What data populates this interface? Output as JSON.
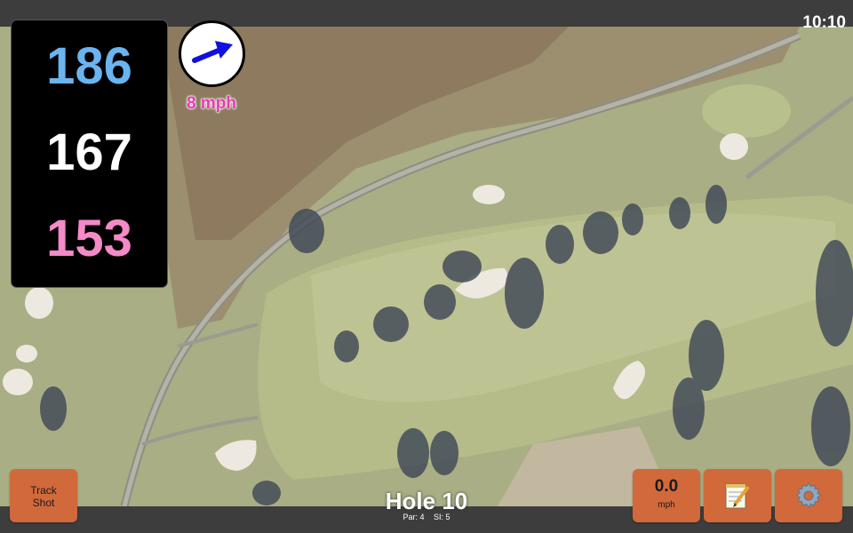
{
  "status": {
    "time": "10:10"
  },
  "distances": {
    "back": "186",
    "middle": "167",
    "front": "153"
  },
  "wind": {
    "speed_label": "8 mph",
    "arrow_icon": "wind-arrow-icon"
  },
  "hole": {
    "title": "Hole 10",
    "par_label": "Par: 4",
    "si_label": "SI: 5"
  },
  "buttons": {
    "track_shot": "Track\nShot",
    "speed_value": "0.0",
    "speed_unit": "mph",
    "notes_icon": "notepad-icon",
    "settings_icon": "gear-icon"
  },
  "colors": {
    "back_distance": "#6ab4f0",
    "middle_distance": "#ffffff",
    "front_distance": "#f48ac8",
    "wind_text": "#e63bb0",
    "button": "#d2693a",
    "arrow": "#1010e0"
  }
}
